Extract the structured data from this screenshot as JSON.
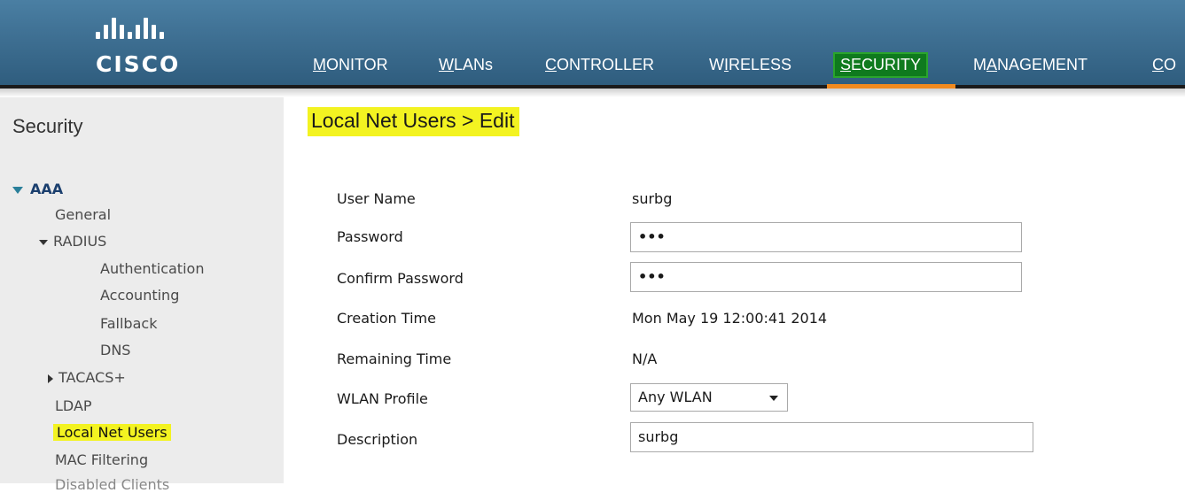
{
  "header": {
    "logo_text": "CISCO",
    "menu": [
      {
        "label": "MONITOR",
        "hotkey": "M",
        "rest": "ONITOR"
      },
      {
        "label": "WLANs",
        "hotkey": "W",
        "rest": "LANs"
      },
      {
        "label": "CONTROLLER",
        "hotkey": "C",
        "rest": "ONTROLLER"
      },
      {
        "label": "WIRELESS",
        "pre": "W",
        "hotkey": "I",
        "rest": "RELESS"
      },
      {
        "label": "SECURITY",
        "hotkey": "S",
        "rest": "ECURITY"
      },
      {
        "label": "MANAGEMENT",
        "pre": "M",
        "hotkey": "A",
        "rest": "NAGEMENT"
      },
      {
        "label": "CO",
        "hotkey": "C",
        "rest": "O"
      }
    ],
    "active_menu": "SECURITY",
    "colors": {
      "bar": "#3e6f92",
      "active_tab_bg": "#0f7a1e",
      "active_tab_line": "#f18a1e"
    }
  },
  "sidebar": {
    "title": "Security",
    "aaa_label": "AAA",
    "general": "General",
    "radius_label": "RADIUS",
    "radius_items": [
      "Authentication",
      "Accounting",
      "Fallback",
      "DNS"
    ],
    "tacacs_label": "TACACS+",
    "ldap": "LDAP",
    "local_net_users": "Local Net Users",
    "mac_filtering": "MAC Filtering",
    "cut_item": "Disabled Clients"
  },
  "main": {
    "title": "Local Net Users > Edit",
    "highlight_color": "#f3f321",
    "fields": {
      "user_name": {
        "label": "User Name",
        "value": "surbg"
      },
      "password": {
        "label": "Password",
        "value": "•••"
      },
      "confirm_password": {
        "label": "Confirm Password",
        "value": "•••"
      },
      "creation_time": {
        "label": "Creation Time",
        "value": "Mon May 19 12:00:41 2014"
      },
      "remaining_time": {
        "label": "Remaining Time",
        "value": "N/A"
      },
      "wlan_profile": {
        "label": "WLAN Profile",
        "value": "Any WLAN"
      },
      "description": {
        "label": "Description",
        "value": "surbg"
      }
    }
  }
}
